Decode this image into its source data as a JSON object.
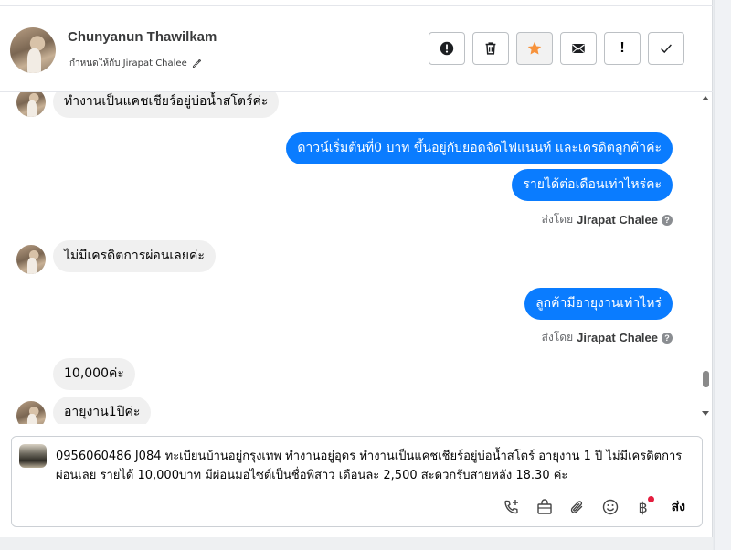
{
  "header": {
    "contact_name": "Chunyanun Thawilkam",
    "assigned_text": "กำหนดให้กับ Jirapat Chalee",
    "buttons": [
      {
        "name": "spam",
        "label": "!"
      },
      {
        "name": "delete",
        "label": ""
      },
      {
        "name": "star",
        "label": ""
      },
      {
        "name": "mark-unread",
        "label": ""
      },
      {
        "name": "follow-up",
        "label": "!"
      },
      {
        "name": "done",
        "label": ""
      }
    ]
  },
  "messages": [
    {
      "dir": "in",
      "text": "ทำงานเป็นแคชเชียร์อยู่บ่อน้ำสโตร์ค่ะ"
    },
    {
      "dir": "out",
      "text": "ดาวน์เริ่มต้นที่0 บาท ขึ้นอยู่กับยอดจัดไฟแนนท์ และเครดิตลูกค้าค่ะ"
    },
    {
      "dir": "out",
      "text": "รายได้ต่อเดือนเท่าไหร่คะ"
    },
    {
      "sent_by_label": "ส่งโดย",
      "sent_by_name": "Jirapat Chalee"
    },
    {
      "dir": "in",
      "text": "ไม่มีเครดิตการผ่อนเลยค่ะ"
    },
    {
      "dir": "out",
      "text": "ลูกค้ามีอายุงานเท่าไหร่"
    },
    {
      "sent_by_label": "ส่งโดย",
      "sent_by_name": "Jirapat Chalee"
    },
    {
      "dir": "in",
      "text": "10,000ค่ะ"
    },
    {
      "dir": "in",
      "text": "อายุงาน1ปีค่ะ"
    }
  ],
  "composer": {
    "value": "0956060486 J084 ทะเบียนบ้านอยู่กรุงเทพ ทำงานอยู่อุดร ทำงานเป็นแคชเชียร์อยู่บ่อน้ำสโตร์ อายุงาน 1 ปี ไม่มีเครดิตการผ่อนเลย รายได้ 10,000บาท มีผ่อนมอไซต์เป็นชื่อพี่สาว เดือนละ 2,500 สะดวกรับสายหลัง 18.30 ค่ะ",
    "send_label": "ส่ง",
    "baht_symbol": "฿",
    "tools": [
      "phone-plus-icon",
      "shopping-bag-icon",
      "paperclip-icon",
      "smiley-icon",
      "baht-icon"
    ]
  },
  "colors": {
    "outgoing_bubble": "#0a7cff",
    "incoming_bubble": "#f0f0f0",
    "star": "#f7923b",
    "notification_dot": "#e41e3f"
  }
}
